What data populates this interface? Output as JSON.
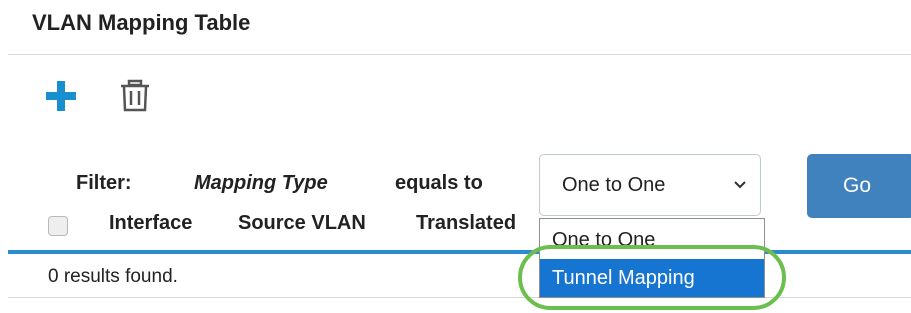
{
  "page": {
    "title": "VLAN Mapping Table"
  },
  "toolbar": {
    "add_icon": "plus-icon",
    "delete_icon": "trash-icon",
    "add_color": "#1a8fd0",
    "delete_color": "#555555"
  },
  "filter": {
    "label": "Filter:",
    "field": "Mapping Type",
    "operator": "equals to",
    "selected_value": "One to One",
    "options": [
      "One to One",
      "Tunnel Mapping"
    ],
    "highlighted_option": "Tunnel Mapping",
    "go_label": "Go"
  },
  "table": {
    "columns": [
      "Interface",
      "Source VLAN",
      "Translated"
    ],
    "results_text": "0 results found."
  },
  "colors": {
    "go_button": "#3f82bd",
    "accent_rule": "#2b8bcf",
    "option_highlight": "#1675d1",
    "callout_ring": "#6cbf4e"
  }
}
